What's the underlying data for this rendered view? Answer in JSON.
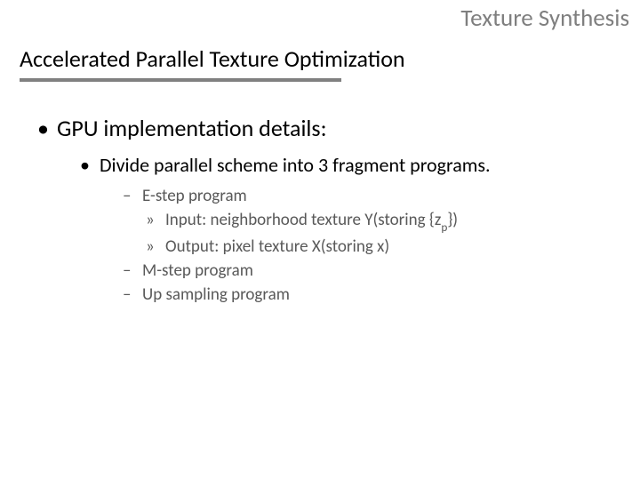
{
  "header": {
    "label": "Texture Synthesis"
  },
  "title": "Accelerated Parallel Texture Optimization",
  "bullets": {
    "l1_1": "GPU implementation details:",
    "l2_1": "Divide parallel scheme into 3 fragment programs.",
    "l3_1": "E-step program",
    "l4_1_pre": "Input: neighborhood texture Y(storing {z",
    "l4_1_sub": "p",
    "l4_1_post": "})",
    "l4_2": "Output: pixel texture X(storing x)",
    "l3_2": "M-step program",
    "l3_3": "Up sampling program"
  },
  "glyphs": {
    "dot": "•",
    "dash": "–",
    "raquo": "»"
  }
}
